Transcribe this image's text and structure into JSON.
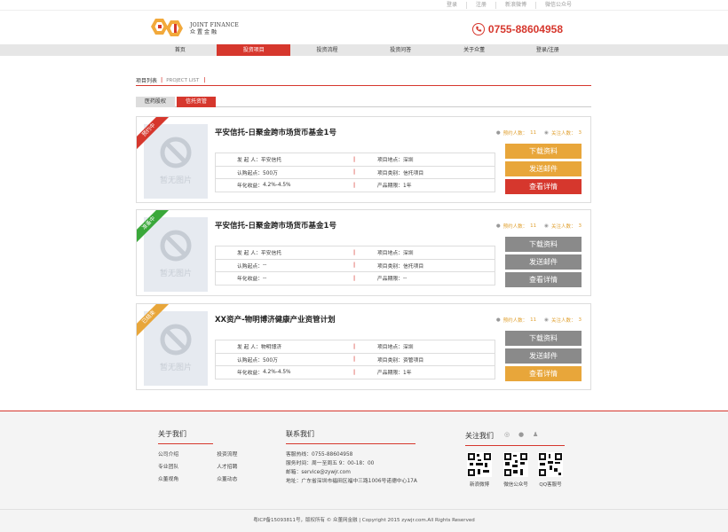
{
  "topbar": {
    "links": [
      "登录",
      "注册",
      "新浪微博",
      "微信公众号"
    ]
  },
  "brand": {
    "logo_en": "JOINT FINANCE",
    "logo_cn": "众置金融",
    "hotline": "0755-88604958"
  },
  "nav": [
    "首页",
    "投资项目",
    "投资流程",
    "投资问答",
    "关于众董",
    "登录/注册"
  ],
  "nav_active": 1,
  "breadcrumb": {
    "cn": "项目列表",
    "sep": "|",
    "en": "PROJECT LIST",
    "bar": "|"
  },
  "tabs": [
    "医药股权",
    "信托资管"
  ],
  "labels": {
    "initiator": "发 起 人：",
    "location": "项目地点：",
    "minimum": "认购起点：",
    "category": "项目类别：",
    "yield": "年化收益：",
    "term": "产品期限：",
    "subscribers": "预约人数：",
    "followers": "关注人数：",
    "no_image": "暂无图片"
  },
  "projects": [
    {
      "status": "预约中",
      "status_color": "#d6372d",
      "title": "平安信托-日聚金跨市场货币基金1号",
      "subscribers": "11",
      "followers": "3",
      "initiator": "平安信托",
      "location": "深圳",
      "minimum": "500万",
      "category": "信托项目",
      "yield": "4.2%-4.5%",
      "term": "1年",
      "buttons": [
        "下载资料",
        "发送邮件",
        "查看详情"
      ],
      "button_styles": [
        "orange",
        "orange",
        "red"
      ]
    },
    {
      "status": "准备中",
      "status_color": "#3aa83a",
      "title": "平安信托-日聚金跨市场货币基金1号",
      "subscribers": "11",
      "followers": "3",
      "initiator": "平安信托",
      "location": "深圳",
      "minimum": "--",
      "category": "信托项目",
      "yield": "--",
      "term": "--",
      "buttons": [
        "下载资料",
        "发送邮件",
        "查看详情"
      ],
      "button_styles": [
        "gray",
        "gray",
        "gray"
      ]
    },
    {
      "status": "已结束",
      "status_color": "#e8a63a",
      "title": "XX资产-物明博济健康产业资管计划",
      "subscribers": "11",
      "followers": "3",
      "initiator": "物明博济",
      "location": "深圳",
      "minimum": "500万",
      "category": "资管项目",
      "yield": "4.2%-4.5%",
      "term": "1年",
      "buttons": [
        "下载资料",
        "发送邮件",
        "查看详情"
      ],
      "button_styles": [
        "gray",
        "gray",
        "orange"
      ]
    }
  ],
  "footer": {
    "about_title": "关于我们",
    "about_links": [
      "公司介绍",
      "投资流程",
      "专业团队",
      "人才招聘",
      "众董视角",
      "众董动态"
    ],
    "contact_title": "联系我们",
    "contact_lines": [
      "客服热线：0755-88604958",
      "服务时间：周一至周五   9：00-18：00",
      "邮箱：service@zywjr.com",
      "地址：广东省深圳市福田区福中三路1006号诺德中心17A"
    ],
    "follow_title": "关注我们",
    "qr_labels": [
      "新浪微博",
      "微信公众号",
      "QQ客服号"
    ],
    "copyright": "粤ICP备15093811号，版权所有 © 众董网金融    |    Copyright 2015 zywjr.com.All Rights Reserved"
  }
}
